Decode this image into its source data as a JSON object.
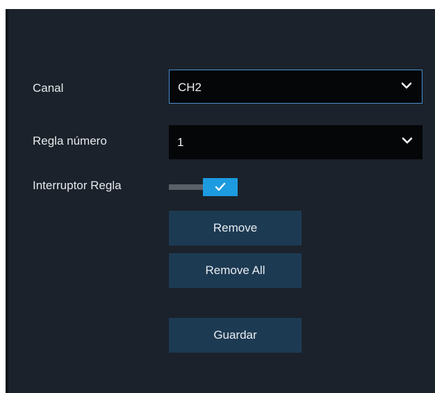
{
  "form": {
    "channel": {
      "label": "Canal",
      "value": "CH2"
    },
    "rule_number": {
      "label": "Regla número",
      "value": "1"
    },
    "rule_switch": {
      "label": "Interruptor Regla",
      "enabled": true
    }
  },
  "buttons": {
    "remove": "Remove",
    "remove_all": "Remove All",
    "save": "Guardar"
  },
  "icons": {
    "dropdown": "chevron-down-icon",
    "toggle_on": "checkmark-icon"
  },
  "colors": {
    "panel_background": "#1b222b",
    "select_background": "#050608",
    "focus_border": "#4a8fd1",
    "toggle_on": "#1d9be0",
    "button_background": "#1d3a53"
  }
}
